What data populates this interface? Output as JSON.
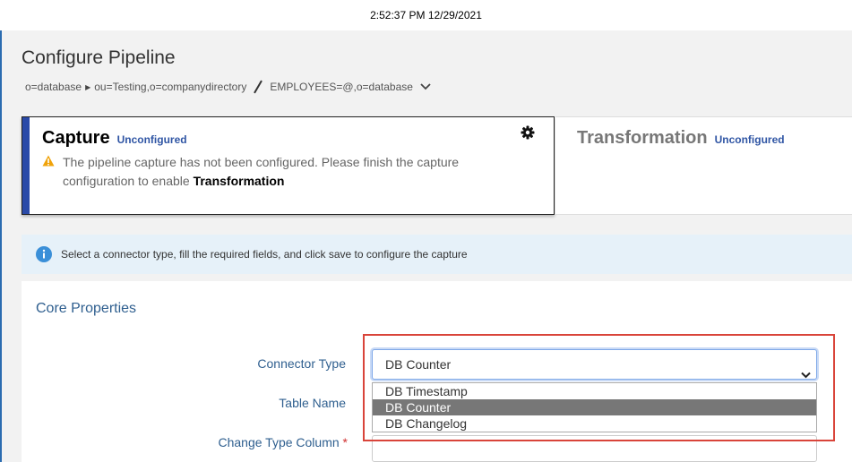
{
  "clock": "2:52:37 PM 12/29/2021",
  "page_title": "Configure Pipeline",
  "breadcrumb": {
    "item1": "o=database",
    "item2": "ou=Testing,o=companydirectory",
    "item3": "EMPLOYEES=@,o=database"
  },
  "capture": {
    "title": "Capture",
    "badge": "Unconfigured",
    "message": "The pipeline capture has not been configured. Please finish the capture configuration to enable ",
    "message_bold": "Transformation"
  },
  "transformation": {
    "title": "Transformation",
    "badge": "Unconfigured"
  },
  "info": "Select a connector type, fill the required fields, and click save to configure the capture",
  "core": {
    "heading": "Core Properties",
    "connector_type_label": "Connector Type",
    "table_name_label": "Table Name",
    "change_type_label": "Change Type Column",
    "required_mark": "*",
    "connector_type_value": "DB Counter",
    "options": [
      "DB Timestamp",
      "DB Counter",
      "DB Changelog"
    ]
  },
  "colors": {
    "accent": "#2a4aa8",
    "highlight": "#d9443a",
    "selected_option": "#777777"
  }
}
